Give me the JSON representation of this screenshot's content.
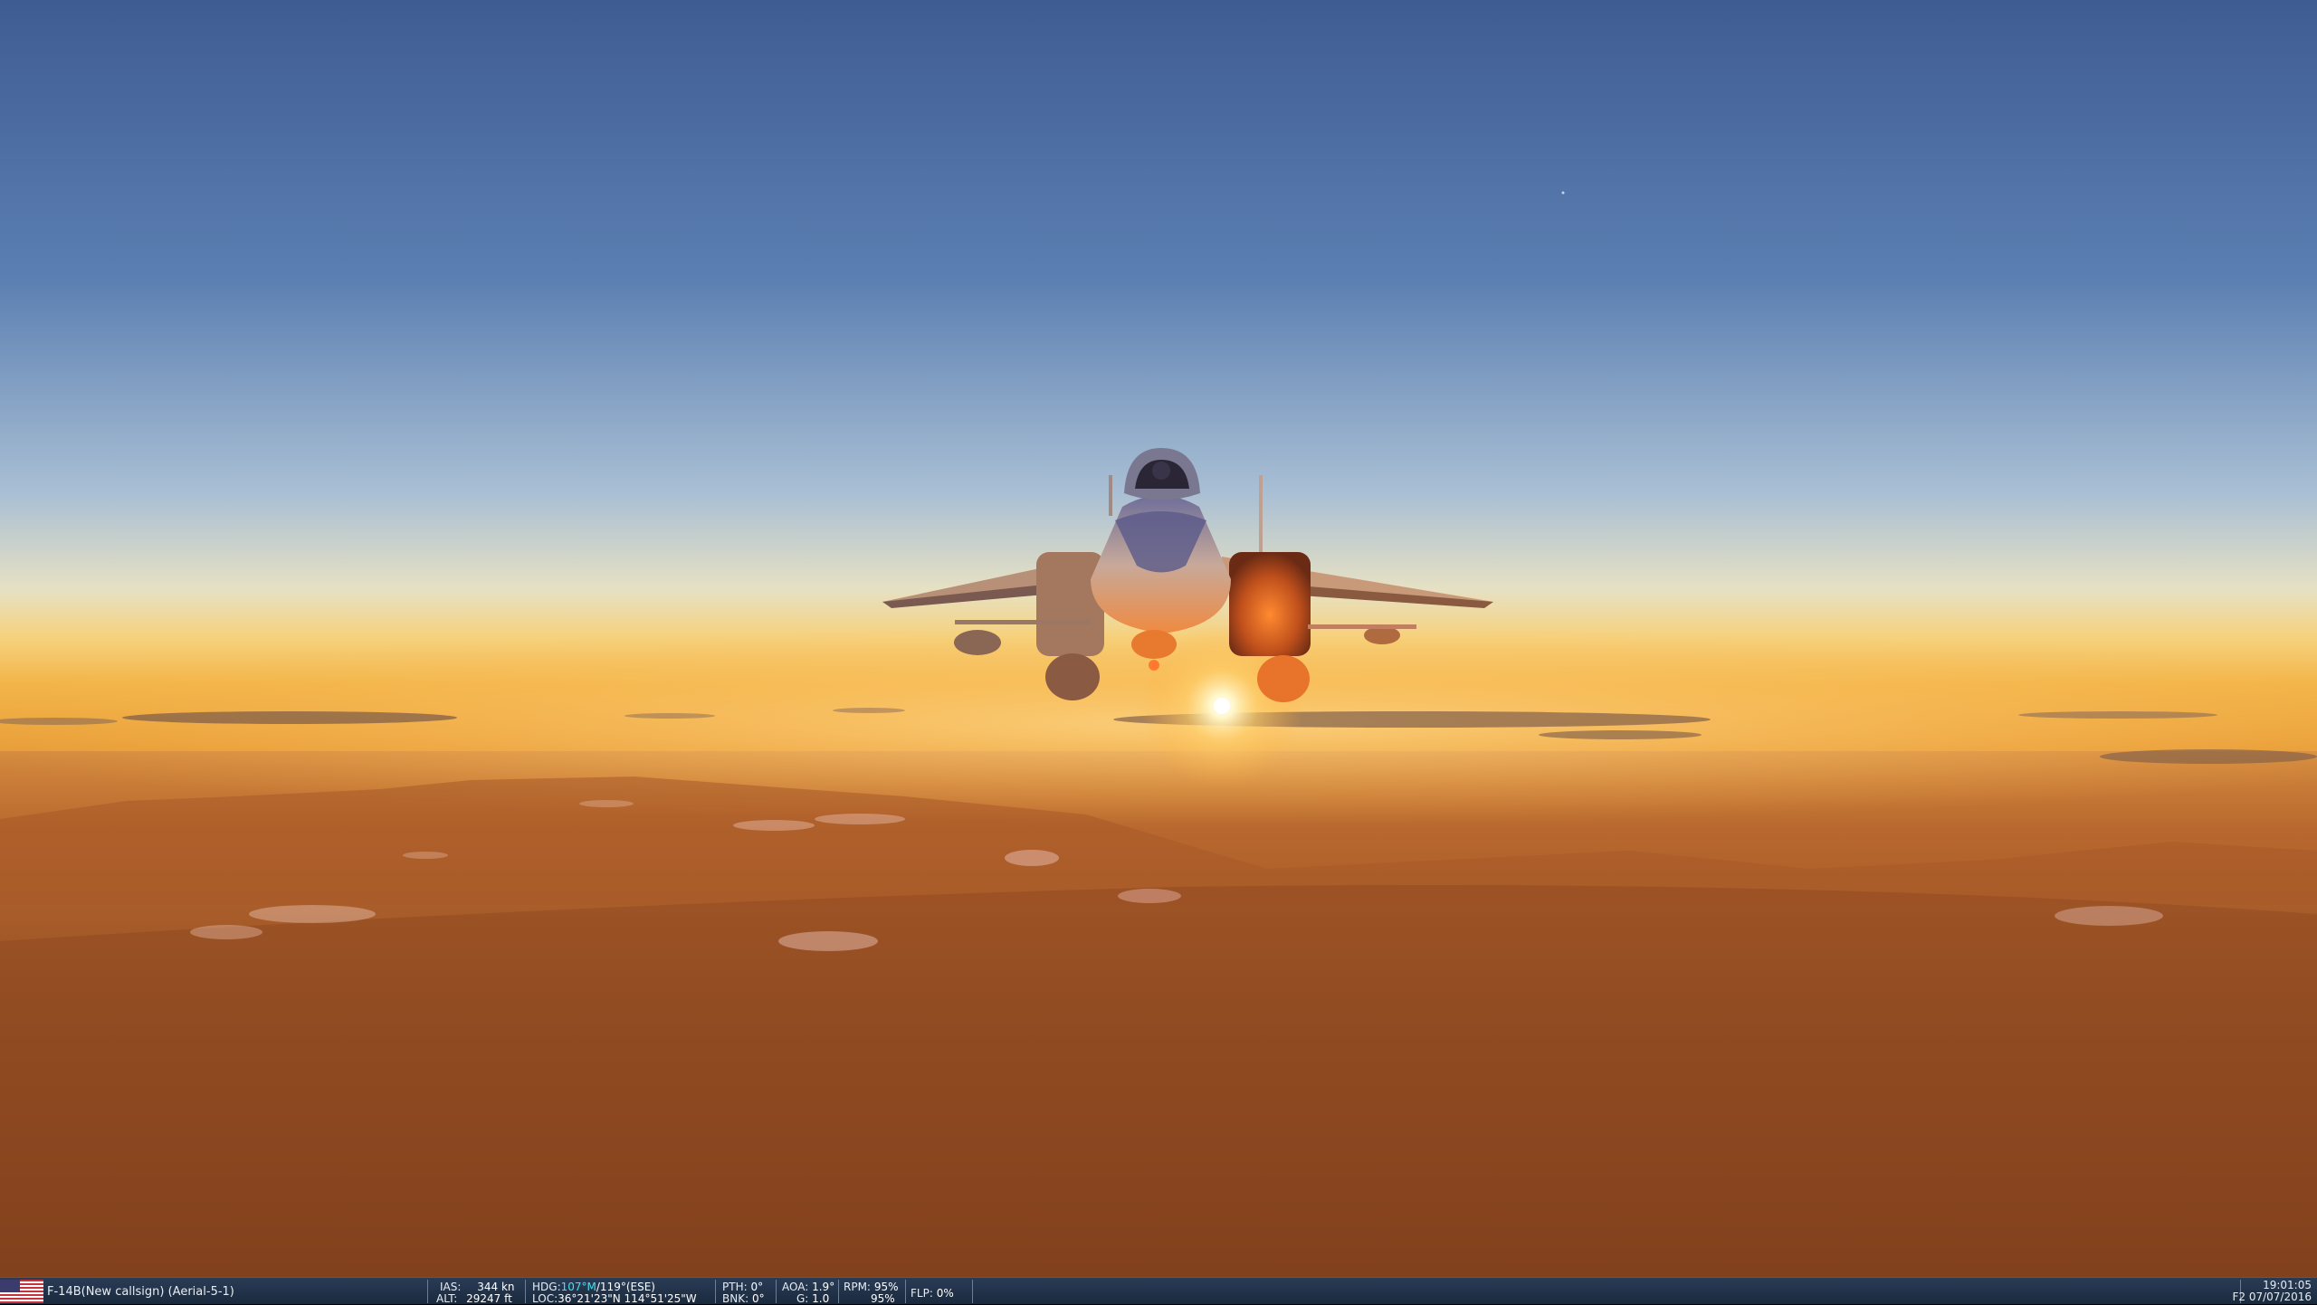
{
  "status_bar": {
    "aircraft": "F-14B(New callsign) (Aerial-5-1)",
    "ias_label": "IAS:",
    "ias_value": "344 kn",
    "alt_label": "ALT:",
    "alt_value": "29247 ft",
    "hdg_label": "HDG:",
    "hdg_mag": "107°M",
    "hdg_true": "/119°(ESE)",
    "loc_label": "LOC:",
    "loc_value": "36°21'23\"N 114°51'25\"W",
    "pth_label": "PTH:",
    "pth_value": "0°",
    "bnk_label": "BNK:",
    "bnk_value": "0°",
    "aoa_label": "AOA:",
    "aoa_value": "1.9°",
    "g_label": "G:",
    "g_value": "1.0",
    "rpm_label": "RPM:",
    "rpm_value_1": "95%",
    "rpm_value_2": "95%",
    "flp_label": "FLP:",
    "flp_value": "0%",
    "time": "19:01:05",
    "date": "F2 07/07/2016"
  },
  "colors": {
    "sky_top": "#3f5e93",
    "horizon_glow": "#f2b040",
    "ground": "#8a4a22",
    "status_bg": "#1e2f45",
    "heading_accent": "#45e0f0"
  }
}
